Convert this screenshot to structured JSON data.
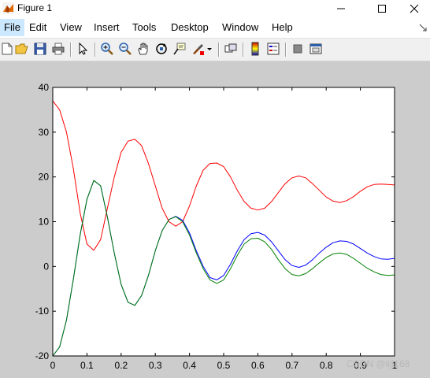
{
  "window": {
    "title": "Figure 1"
  },
  "menu": [
    "File",
    "Edit",
    "View",
    "Insert",
    "Tools",
    "Desktop",
    "Window",
    "Help"
  ],
  "toolbar": {
    "buttons": [
      "new-figure-icon",
      "open-file-icon",
      "save-icon",
      "print-icon",
      "pointer-icon",
      "zoom-in-icon",
      "zoom-out-icon",
      "pan-icon",
      "rotate-3d-icon",
      "data-cursor-icon",
      "brush-icon",
      "brush-dropdown-icon",
      "link-icon",
      "colorbar-icon",
      "legend-icon",
      "hide-tools-icon",
      "dock-icon"
    ]
  },
  "watermark": "CSDN @lijl168",
  "colors": {
    "series1": "#ff0000",
    "series2": "#0000ff",
    "series3": "#008000"
  },
  "chart_data": {
    "type": "line",
    "title": "",
    "xlabel": "",
    "ylabel": "",
    "xlim": [
      0,
      1
    ],
    "ylim": [
      -20,
      40
    ],
    "xticks": [
      "0",
      "0.1",
      "0.2",
      "0.3",
      "0.4",
      "0.5",
      "0.6",
      "0.7",
      "0.8",
      "0.9",
      "1"
    ],
    "yticks": [
      "-20",
      "-10",
      "0",
      "10",
      "20",
      "30",
      "40"
    ],
    "grid": false,
    "series": [
      {
        "color": "#ff0000",
        "points": [
          [
            0,
            37
          ],
          [
            0.02,
            35
          ],
          [
            0.04,
            30
          ],
          [
            0.06,
            22
          ],
          [
            0.08,
            12
          ],
          [
            0.1,
            5
          ],
          [
            0.12,
            3.6
          ],
          [
            0.14,
            6
          ],
          [
            0.16,
            13
          ],
          [
            0.18,
            20
          ],
          [
            0.2,
            25.5
          ],
          [
            0.22,
            28
          ],
          [
            0.24,
            28.4
          ],
          [
            0.26,
            27
          ],
          [
            0.28,
            23
          ],
          [
            0.3,
            18
          ],
          [
            0.32,
            13
          ],
          [
            0.34,
            10
          ],
          [
            0.36,
            9
          ],
          [
            0.38,
            10
          ],
          [
            0.4,
            13.5
          ],
          [
            0.42,
            18
          ],
          [
            0.44,
            21.5
          ],
          [
            0.46,
            23
          ],
          [
            0.48,
            23.1
          ],
          [
            0.5,
            22.3
          ],
          [
            0.52,
            20
          ],
          [
            0.54,
            17
          ],
          [
            0.56,
            14.5
          ],
          [
            0.58,
            13
          ],
          [
            0.6,
            12.6
          ],
          [
            0.62,
            13
          ],
          [
            0.64,
            14.5
          ],
          [
            0.66,
            16.5
          ],
          [
            0.68,
            18.5
          ],
          [
            0.7,
            19.8
          ],
          [
            0.72,
            20.2
          ],
          [
            0.74,
            19.8
          ],
          [
            0.76,
            18.5
          ],
          [
            0.78,
            17
          ],
          [
            0.8,
            15.5
          ],
          [
            0.82,
            14.6
          ],
          [
            0.84,
            14.3
          ],
          [
            0.86,
            14.7
          ],
          [
            0.88,
            15.6
          ],
          [
            0.9,
            16.8
          ],
          [
            0.92,
            17.8
          ],
          [
            0.94,
            18.3
          ],
          [
            0.96,
            18.4
          ],
          [
            0.98,
            18.3
          ],
          [
            1,
            18.2
          ]
        ]
      },
      {
        "color": "#0000ff",
        "points": [
          [
            0,
            -20
          ],
          [
            0.02,
            -18
          ],
          [
            0.04,
            -12
          ],
          [
            0.06,
            -3
          ],
          [
            0.08,
            7
          ],
          [
            0.1,
            15
          ],
          [
            0.12,
            19.2
          ],
          [
            0.14,
            18
          ],
          [
            0.16,
            11
          ],
          [
            0.18,
            3
          ],
          [
            0.2,
            -4
          ],
          [
            0.22,
            -8
          ],
          [
            0.24,
            -8.7
          ],
          [
            0.26,
            -6.5
          ],
          [
            0.28,
            -2
          ],
          [
            0.3,
            3.5
          ],
          [
            0.32,
            8
          ],
          [
            0.34,
            10.5
          ],
          [
            0.36,
            11.2
          ],
          [
            0.38,
            10.3
          ],
          [
            0.4,
            7.5
          ],
          [
            0.42,
            3.5
          ],
          [
            0.44,
            0
          ],
          [
            0.46,
            -2.5
          ],
          [
            0.48,
            -3
          ],
          [
            0.5,
            -2
          ],
          [
            0.52,
            0.5
          ],
          [
            0.54,
            3.5
          ],
          [
            0.56,
            6
          ],
          [
            0.58,
            7.3
          ],
          [
            0.6,
            7.6
          ],
          [
            0.62,
            7
          ],
          [
            0.64,
            5.5
          ],
          [
            0.66,
            3.5
          ],
          [
            0.68,
            1.5
          ],
          [
            0.7,
            0.2
          ],
          [
            0.72,
            -0.2
          ],
          [
            0.74,
            0.3
          ],
          [
            0.76,
            1.5
          ],
          [
            0.78,
            3
          ],
          [
            0.8,
            4.3
          ],
          [
            0.82,
            5.3
          ],
          [
            0.84,
            5.7
          ],
          [
            0.86,
            5.6
          ],
          [
            0.88,
            5
          ],
          [
            0.9,
            4
          ],
          [
            0.92,
            3
          ],
          [
            0.94,
            2.2
          ],
          [
            0.96,
            1.7
          ],
          [
            0.98,
            1.6
          ],
          [
            1,
            1.8
          ]
        ]
      },
      {
        "color": "#008000",
        "points": [
          [
            0,
            -20
          ],
          [
            0.02,
            -18
          ],
          [
            0.04,
            -12
          ],
          [
            0.06,
            -3
          ],
          [
            0.08,
            7
          ],
          [
            0.1,
            15
          ],
          [
            0.12,
            19.2
          ],
          [
            0.14,
            18
          ],
          [
            0.16,
            11
          ],
          [
            0.18,
            3
          ],
          [
            0.2,
            -4
          ],
          [
            0.22,
            -8
          ],
          [
            0.24,
            -8.7
          ],
          [
            0.26,
            -6.5
          ],
          [
            0.28,
            -2
          ],
          [
            0.3,
            3.5
          ],
          [
            0.32,
            8
          ],
          [
            0.34,
            10.5
          ],
          [
            0.36,
            11.1
          ],
          [
            0.38,
            10
          ],
          [
            0.4,
            7
          ],
          [
            0.42,
            3
          ],
          [
            0.44,
            -0.5
          ],
          [
            0.46,
            -3
          ],
          [
            0.48,
            -3.8
          ],
          [
            0.5,
            -3
          ],
          [
            0.52,
            -0.5
          ],
          [
            0.54,
            2.5
          ],
          [
            0.56,
            5
          ],
          [
            0.58,
            6.2
          ],
          [
            0.6,
            6.3
          ],
          [
            0.62,
            5.5
          ],
          [
            0.64,
            3.8
          ],
          [
            0.66,
            1.5
          ],
          [
            0.68,
            -0.5
          ],
          [
            0.7,
            -1.8
          ],
          [
            0.72,
            -2.1
          ],
          [
            0.74,
            -1.6
          ],
          [
            0.76,
            -0.5
          ],
          [
            0.78,
            0.8
          ],
          [
            0.8,
            2
          ],
          [
            0.82,
            2.8
          ],
          [
            0.84,
            3
          ],
          [
            0.86,
            2.7
          ],
          [
            0.88,
            1.8
          ],
          [
            0.9,
            0.7
          ],
          [
            0.92,
            -0.4
          ],
          [
            0.94,
            -1.2
          ],
          [
            0.96,
            -1.8
          ],
          [
            0.98,
            -2
          ],
          [
            1,
            -1.9
          ]
        ]
      }
    ]
  }
}
